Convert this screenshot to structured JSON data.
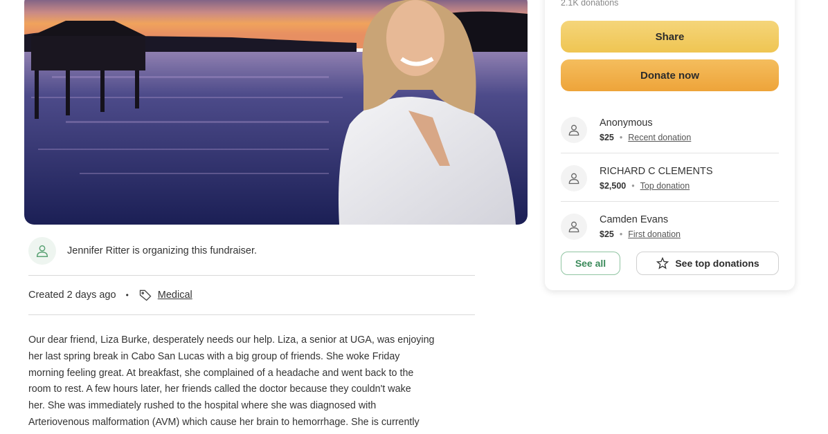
{
  "organizer": {
    "text": "Jennifer Ritter is organizing this fundraiser."
  },
  "meta": {
    "created": "Created 2 days ago",
    "separator": "•",
    "category": "Medical"
  },
  "story": {
    "lines": [
      "Our dear friend, Liza Burke, desperately needs our help. Liza, a senior at UGA, was enjoying",
      "her last spring break in Cabo San Lucas with a big group of friends. She woke Friday",
      "morning feeling great. At breakfast, she complained of a headache and went back to the",
      "room to rest. A few hours later, her friends called the doctor because they couldn't wake",
      "her. She was immediately rushed to the hospital where she was diagnosed with",
      "Arteriovenous malformation (AVM) which cause her brain to hemorrhage. She is currently"
    ]
  },
  "card": {
    "donation_count": "2.1K donations",
    "share_label": "Share",
    "donate_label": "Donate now",
    "donors": [
      {
        "name": "Anonymous",
        "amount": "$25",
        "kind": "Recent donation"
      },
      {
        "name": "RICHARD C CLEMENTS",
        "amount": "$2,500",
        "kind": "Top donation"
      },
      {
        "name": "Camden Evans",
        "amount": "$25",
        "kind": "First donation"
      }
    ],
    "donor_separator": "•",
    "see_all_label": "See all",
    "see_top_label": "See top donations"
  },
  "colors": {
    "share_button": "#efc552",
    "donate_button": "#eea43a",
    "see_all_text": "#3a8a5a"
  },
  "icons": [
    "person-icon",
    "tag-icon",
    "star-icon"
  ]
}
